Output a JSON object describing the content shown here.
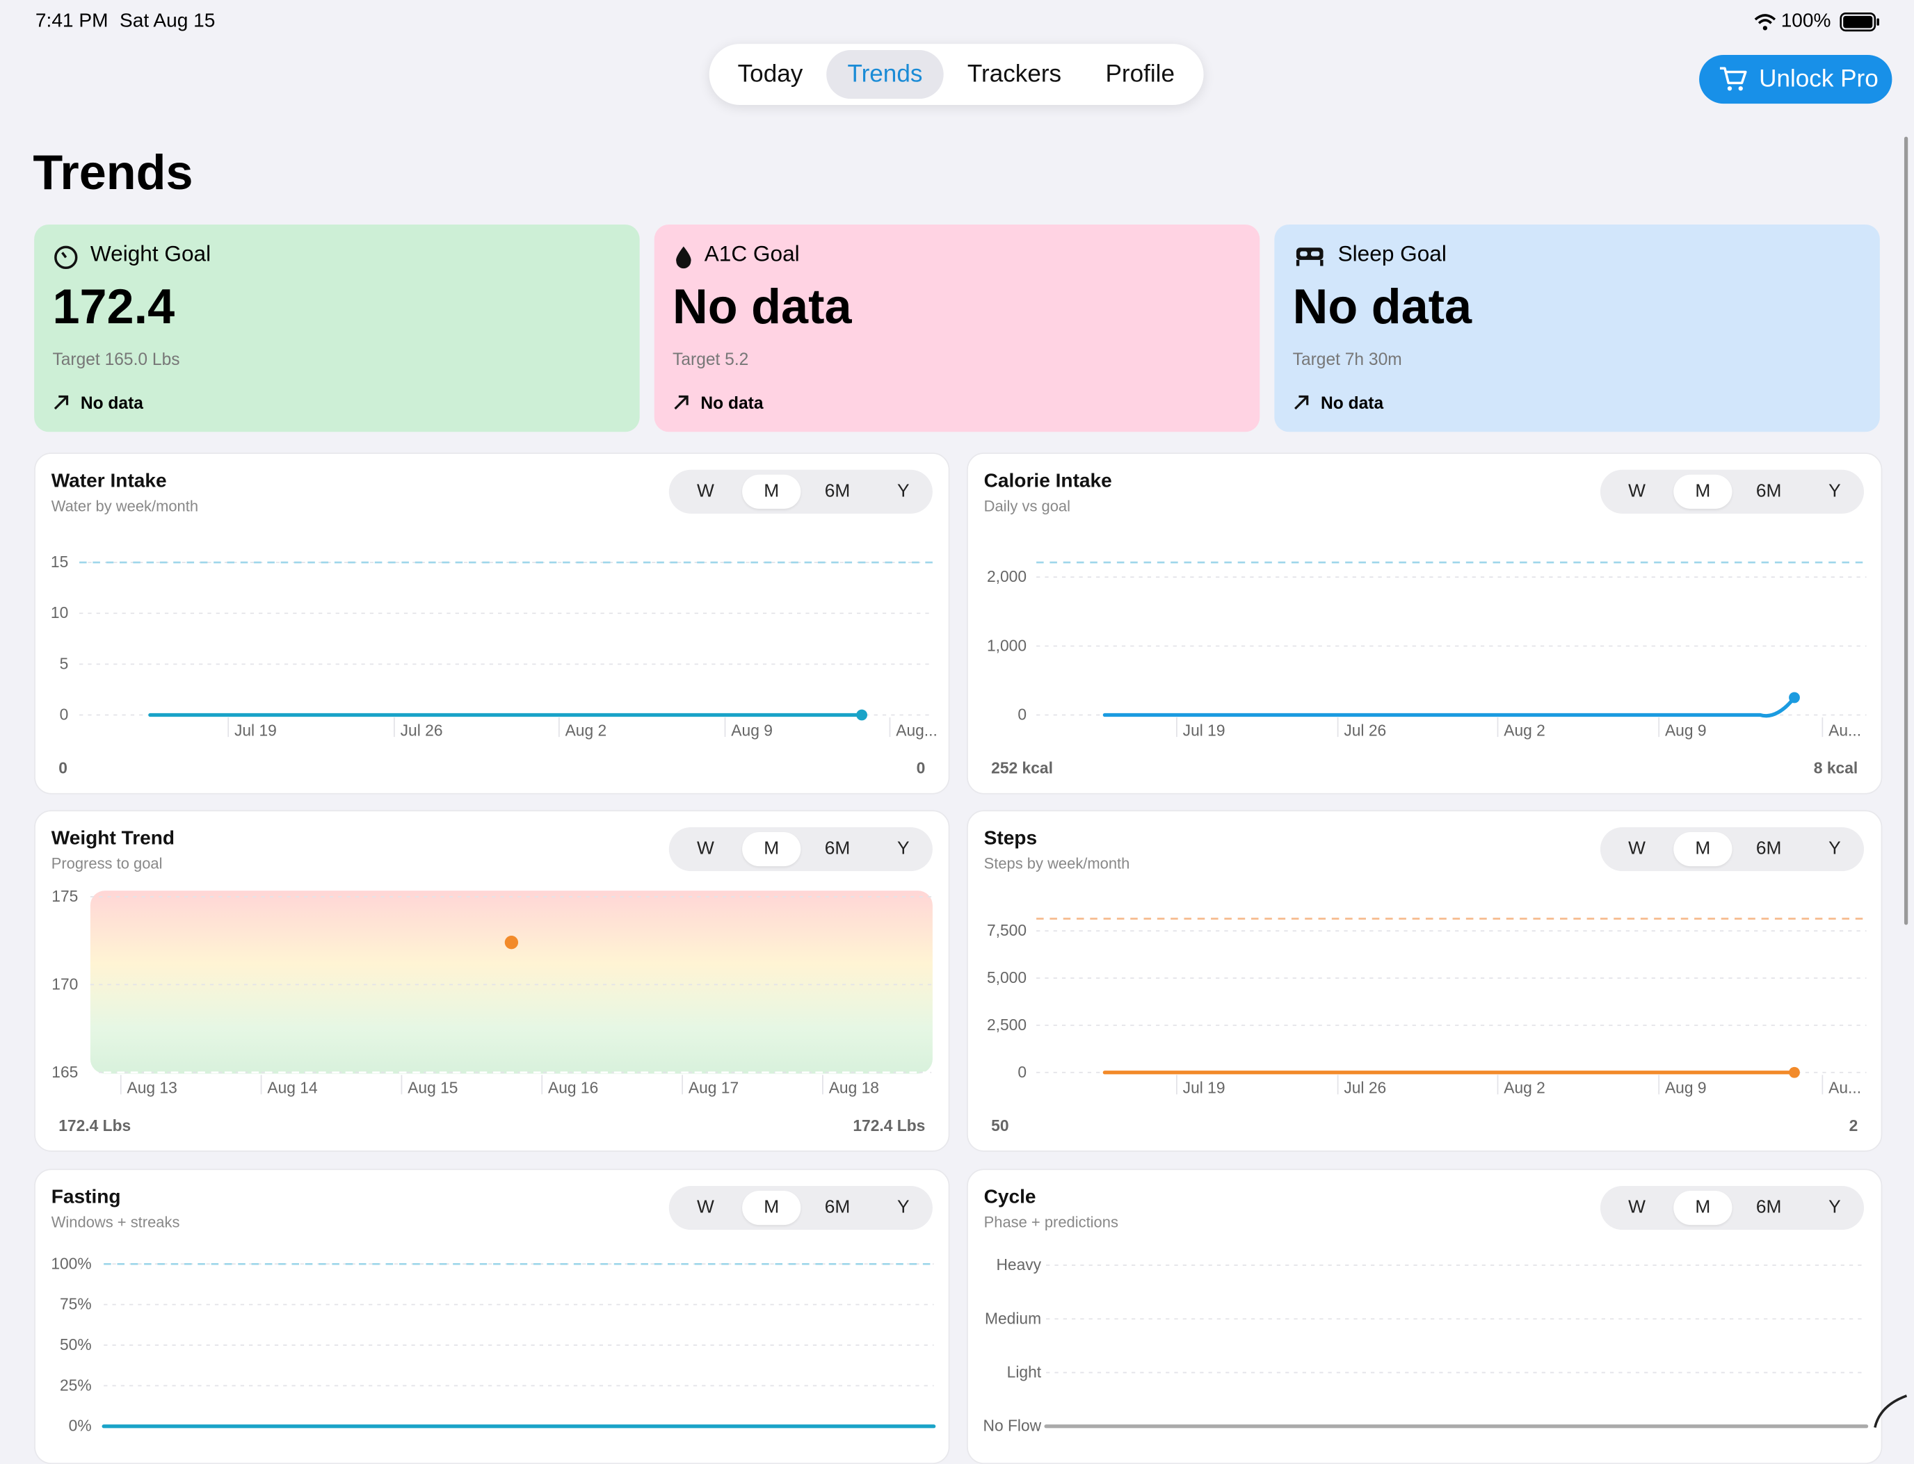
{
  "status_bar": {
    "time": "7:41 PM",
    "date": "Sat Aug 15",
    "battery": "100%"
  },
  "nav": {
    "tabs": [
      "Today",
      "Trends",
      "Trackers",
      "Profile"
    ],
    "selected": "Trends"
  },
  "unlock_label": "Unlock Pro",
  "page_title": "Trends",
  "goals": [
    {
      "title": "Weight Goal",
      "icon": "scale-icon",
      "value": "172.4",
      "target": "Target 165.0 Lbs",
      "trend": "No data",
      "color": "#cdefd6"
    },
    {
      "title": "A1C Goal",
      "icon": "drop-icon",
      "value": "No data",
      "target": "Target 5.2",
      "trend": "No data",
      "color": "#ffd3e3"
    },
    {
      "title": "Sleep Goal",
      "icon": "bed-icon",
      "value": "No data",
      "target": "Target 7h 30m",
      "trend": "No data",
      "color": "#d2e6fb"
    }
  ],
  "range_options": [
    "W",
    "M",
    "6M",
    "Y"
  ],
  "range_selected": "M",
  "panels": {
    "water": {
      "title": "Water Intake",
      "subtitle": "Water by week/month",
      "foot_left": "0",
      "foot_right": "0"
    },
    "calorie": {
      "title": "Calorie Intake",
      "subtitle": "Daily vs goal",
      "foot_left": "252 kcal",
      "foot_right": "8 kcal"
    },
    "weight": {
      "title": "Weight Trend",
      "subtitle": "Progress to goal",
      "foot_left": "172.4 Lbs",
      "foot_right": "172.4 Lbs"
    },
    "steps": {
      "title": "Steps",
      "subtitle": "Steps by week/month",
      "foot_left": "50",
      "foot_right": "2"
    },
    "fasting": {
      "title": "Fasting",
      "subtitle": "Windows + streaks"
    },
    "cycle": {
      "title": "Cycle",
      "subtitle": "Phase + predictions"
    }
  },
  "chart_data": [
    {
      "id": "water",
      "type": "line",
      "color": "#1aa3c8",
      "y_ticks": [
        "0",
        "5",
        "10",
        "15"
      ],
      "ylim": [
        0,
        15
      ],
      "goal_line": 15,
      "x_ticks": [
        "Jul 19",
        "Jul 26",
        "Aug 2",
        "Aug 9",
        "Aug..."
      ],
      "series": [
        {
          "values": [
            0,
            0
          ]
        }
      ]
    },
    {
      "id": "calorie",
      "type": "line",
      "color": "#1b9be0",
      "y_ticks": [
        "0",
        "1,000",
        "2,000"
      ],
      "ylim": [
        0,
        2000
      ],
      "goal_line": 2200,
      "x_ticks": [
        "Jul 19",
        "Jul 26",
        "Aug 2",
        "Aug 9",
        "Au..."
      ],
      "series": [
        {
          "values": [
            0,
            0,
            0,
            0,
            252
          ]
        }
      ]
    },
    {
      "id": "weight",
      "type": "scatter",
      "color": "#f28a2a",
      "y_ticks": [
        "165",
        "170",
        "175"
      ],
      "ylim": [
        163,
        175
      ],
      "goal_line": 165,
      "x_ticks": [
        "Aug 13",
        "Aug 14",
        "Aug 15",
        "Aug 16",
        "Aug 17",
        "Aug 18"
      ],
      "series": [
        {
          "values": [
            172.4
          ]
        }
      ]
    },
    {
      "id": "steps",
      "type": "line",
      "color": "#f28a2a",
      "y_ticks": [
        "0",
        "2,500",
        "5,000",
        "7,500"
      ],
      "ylim": [
        0,
        8000
      ],
      "goal_line": 8000,
      "x_ticks": [
        "Jul 19",
        "Jul 26",
        "Aug 2",
        "Aug 9",
        "Au..."
      ],
      "series": [
        {
          "values": [
            0,
            0
          ]
        }
      ]
    },
    {
      "id": "fasting",
      "type": "line",
      "color": "#1aa3c8",
      "y_ticks": [
        "0%",
        "25%",
        "50%",
        "75%",
        "100%"
      ],
      "ylim": [
        0,
        100
      ],
      "goal_line": 100,
      "series": [
        {
          "values": [
            0,
            0
          ]
        }
      ]
    },
    {
      "id": "cycle",
      "type": "line",
      "color": "#aaaaaa",
      "y_ticks": [
        "No Flow",
        "Light",
        "Medium",
        "Heavy"
      ],
      "ylim": [
        0,
        3
      ],
      "series": [
        {
          "values": [
            0,
            0
          ]
        }
      ]
    }
  ]
}
